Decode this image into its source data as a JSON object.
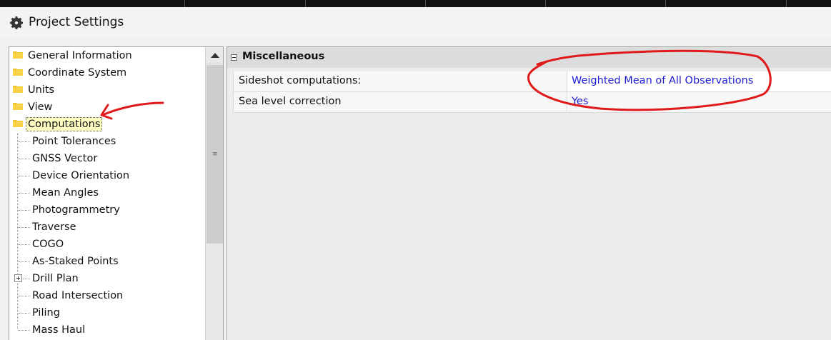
{
  "window": {
    "title": "Project Settings",
    "icon": "gear-icon"
  },
  "tree": {
    "items": [
      {
        "label": "General Information",
        "level": "top",
        "icon": "folder-icon"
      },
      {
        "label": "Coordinate System",
        "level": "top",
        "icon": "folder-icon"
      },
      {
        "label": "Units",
        "level": "top",
        "icon": "folder-icon"
      },
      {
        "label": "View",
        "level": "top",
        "icon": "folder-icon"
      },
      {
        "label": "Computations",
        "level": "top",
        "icon": "folder-icon",
        "selected": true
      },
      {
        "label": "Point Tolerances",
        "level": "child"
      },
      {
        "label": "GNSS Vector",
        "level": "child"
      },
      {
        "label": "Device Orientation",
        "level": "child"
      },
      {
        "label": "Mean Angles",
        "level": "child"
      },
      {
        "label": "Photogrammetry",
        "level": "child"
      },
      {
        "label": "Traverse",
        "level": "child"
      },
      {
        "label": "COGO",
        "level": "child"
      },
      {
        "label": "As-Staked Points",
        "level": "child"
      },
      {
        "label": "Drill Plan",
        "level": "child",
        "expandable": true
      },
      {
        "label": "Road Intersection",
        "level": "child"
      },
      {
        "label": "Piling",
        "level": "child"
      },
      {
        "label": "Mass Haul",
        "level": "child"
      }
    ]
  },
  "properties": {
    "category": "Miscellaneous",
    "rows": [
      {
        "name": "Sideshot computations:",
        "value": "Weighted Mean of All Observations"
      },
      {
        "name": "Sea level correction",
        "value": "Yes"
      }
    ]
  },
  "colors": {
    "value_link": "#1c1ccf",
    "annotation": "#e01a1a",
    "selected_bg": "#ffffc4",
    "folder": "#f2c12e"
  }
}
